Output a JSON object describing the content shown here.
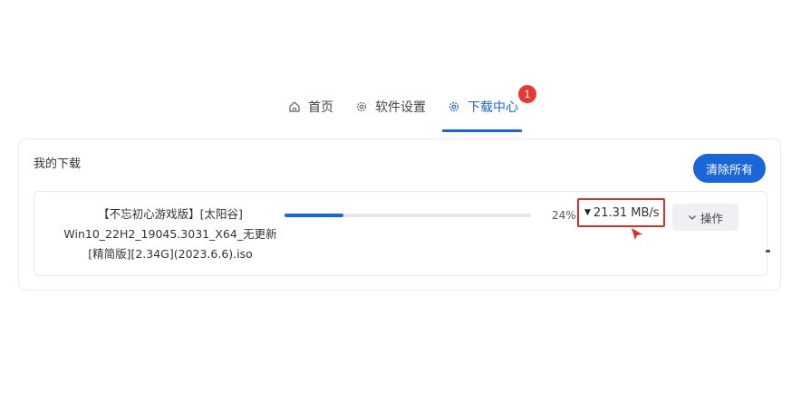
{
  "nav": {
    "tabs": [
      {
        "label": "首页",
        "icon": "home-icon",
        "active": false
      },
      {
        "label": "软件设置",
        "icon": "gear-icon",
        "active": false
      },
      {
        "label": "下载中心",
        "icon": "gear-icon",
        "active": true,
        "badge": "1"
      }
    ]
  },
  "downloads": {
    "title": "我的下载",
    "clear_all_label": "清除所有",
    "items": [
      {
        "name_line1": "【不忘初心游戏版】[太阳谷]",
        "name_line2": "Win10_22H2_19045.3031_X64_无更新",
        "name_line3": "[精简版][2.34G](2023.6.6).iso",
        "progress_percent": 24,
        "progress_label": "24%",
        "speed": "21.31 MB/s",
        "speed_highlight_color": "#d93025",
        "actions_label": "操作"
      }
    ]
  },
  "colors": {
    "accent": "#1a66d8",
    "badge": "#e53935"
  }
}
